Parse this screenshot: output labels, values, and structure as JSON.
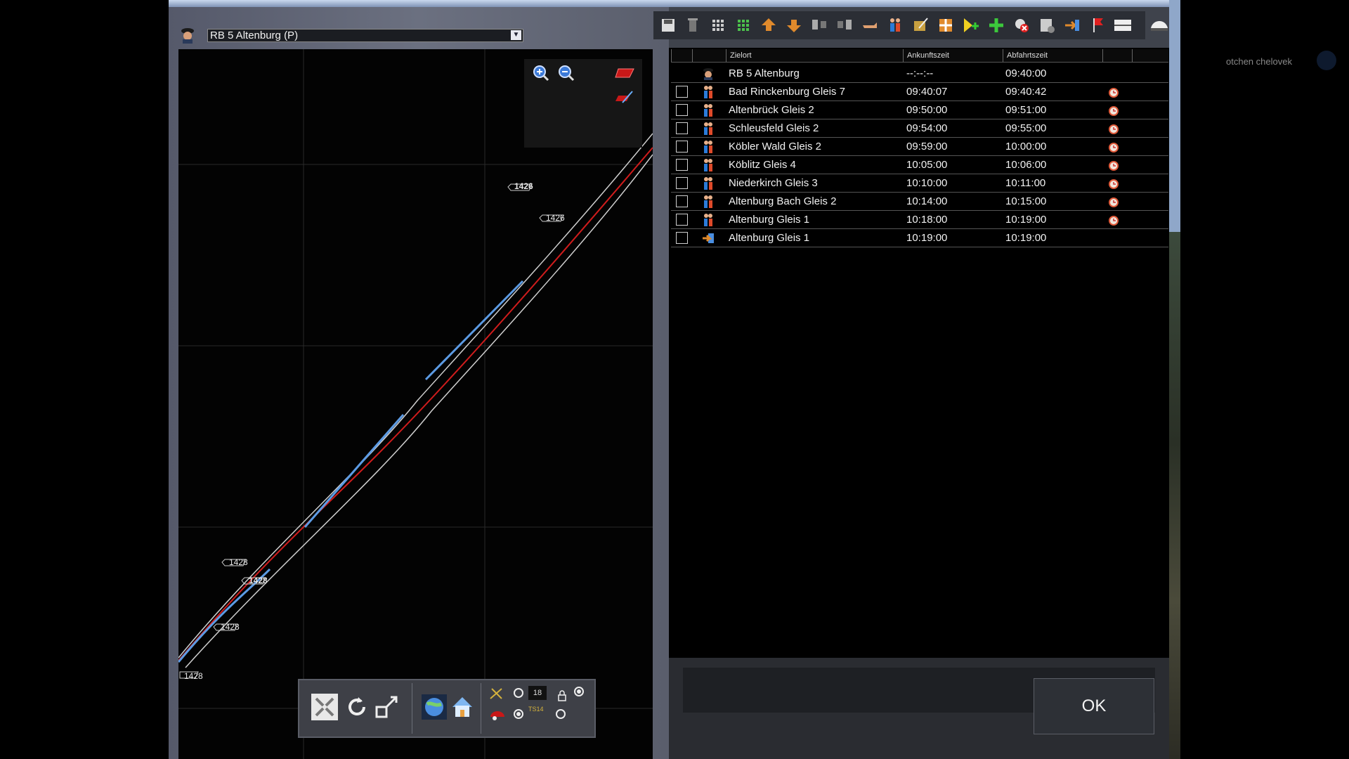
{
  "train_selector": {
    "value": "RB 5 Altenburg (P)"
  },
  "user": {
    "name": "otchen chelovek"
  },
  "table": {
    "headers": {
      "destination": "Zielort",
      "arrival": "Ankunftszeit",
      "departure": "Abfahrtszeit"
    },
    "rows": [
      {
        "type": "driver",
        "destination": "RB 5 Altenburg",
        "arrival": "--:--:--",
        "departure": "09:40:00",
        "alarm": false,
        "checkbox": false
      },
      {
        "type": "passenger",
        "destination": "Bad Rinckenburg Gleis 7",
        "arrival": "09:40:07",
        "departure": "09:40:42",
        "alarm": true,
        "checkbox": true
      },
      {
        "type": "passenger",
        "destination": "Altenbrück Gleis 2",
        "arrival": "09:50:00",
        "departure": "09:51:00",
        "alarm": true,
        "checkbox": true
      },
      {
        "type": "passenger",
        "destination": "Schleusfeld Gleis 2",
        "arrival": "09:54:00",
        "departure": "09:55:00",
        "alarm": true,
        "checkbox": true
      },
      {
        "type": "passenger",
        "destination": "Köbler Wald Gleis 2",
        "arrival": "09:59:00",
        "departure": "10:00:00",
        "alarm": true,
        "checkbox": true
      },
      {
        "type": "passenger",
        "destination": "Köblitz Gleis 4",
        "arrival": "10:05:00",
        "departure": "10:06:00",
        "alarm": true,
        "checkbox": true
      },
      {
        "type": "passenger",
        "destination": "Niederkirch Gleis 3",
        "arrival": "10:10:00",
        "departure": "10:11:00",
        "alarm": true,
        "checkbox": true
      },
      {
        "type": "passenger",
        "destination": "Altenburg Bach Gleis 2",
        "arrival": "10:14:00",
        "departure": "10:15:00",
        "alarm": true,
        "checkbox": true
      },
      {
        "type": "passenger",
        "destination": "Altenburg Gleis 1",
        "arrival": "10:18:00",
        "departure": "10:19:00",
        "alarm": true,
        "checkbox": true
      },
      {
        "type": "goto",
        "destination": "Altenburg Gleis 1",
        "arrival": "10:19:00",
        "departure": "10:19:00",
        "alarm": false,
        "checkbox": true
      }
    ]
  },
  "map": {
    "speed_labels": [
      "1426",
      "1426",
      "1428",
      "1428",
      "1428",
      "1428"
    ],
    "map_toolbar_value": "18",
    "map_toolbar_ts": "TS14"
  },
  "ok_button": {
    "label": "OK"
  },
  "toolbar_icons": [
    "save-icon",
    "delete-icon",
    "grid-icon",
    "grid-green-icon",
    "move-up-icon",
    "move-down-icon",
    "split-icon",
    "merge-icon",
    "hand-icon",
    "passengers-icon",
    "edit-icon",
    "cross-icon",
    "add-yellow-icon",
    "add-green-icon",
    "remove-icon",
    "settings-icon",
    "enter-icon",
    "flag-icon",
    "list-icon",
    "train-icon"
  ],
  "colors": {
    "route_red": "#d01c1c",
    "route_blue": "#4f8fd8",
    "track": "#cfcfcf"
  }
}
